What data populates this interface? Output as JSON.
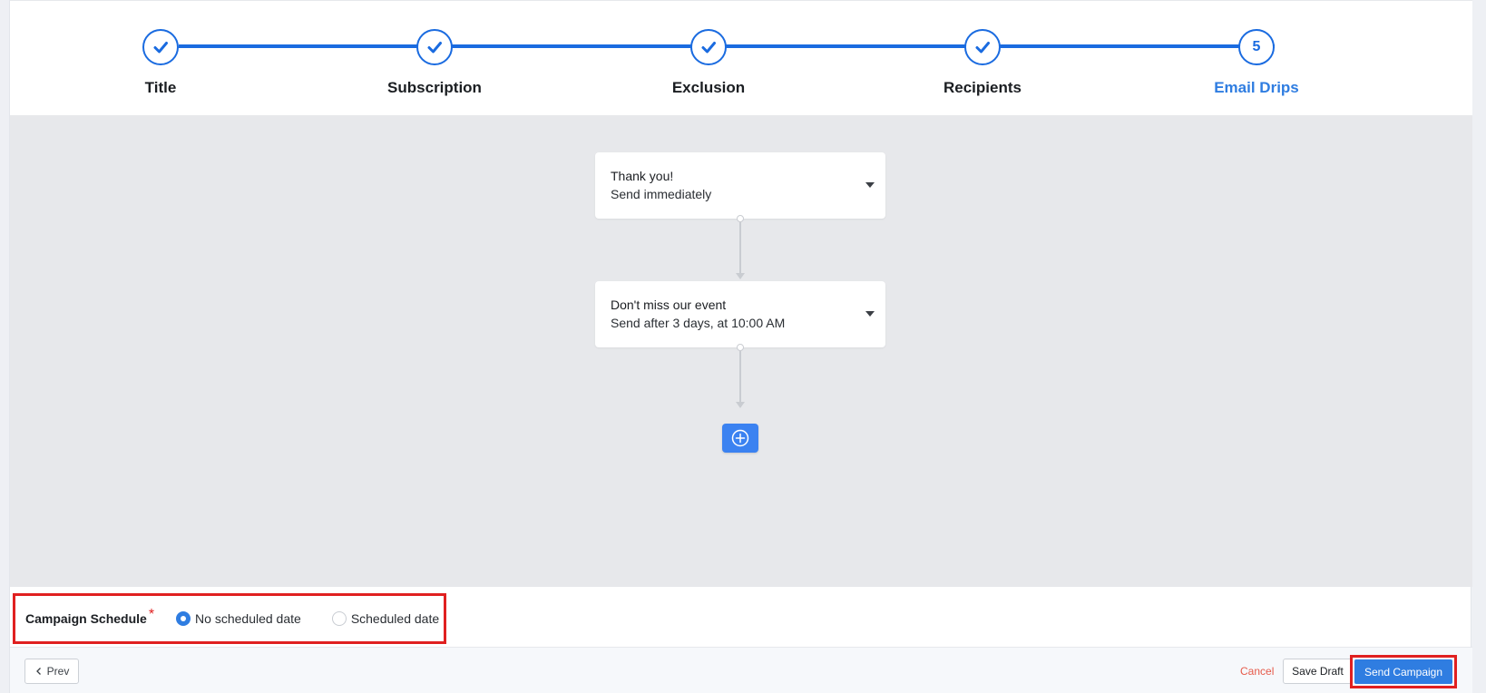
{
  "stepper": {
    "accent_color": "#1a6be0",
    "steps": [
      {
        "label": "Title",
        "state": "completed",
        "icon": "check-icon"
      },
      {
        "label": "Subscription",
        "state": "completed",
        "icon": "check-icon"
      },
      {
        "label": "Exclusion",
        "state": "completed",
        "icon": "check-icon"
      },
      {
        "label": "Recipients",
        "state": "completed",
        "icon": "check-icon"
      },
      {
        "label": "Email Drips",
        "state": "active",
        "number": "5"
      }
    ]
  },
  "drips": [
    {
      "title": "Thank you!",
      "timing": "Send immediately"
    },
    {
      "title": "Don't miss our event",
      "timing": "Send after 3 days, at 10:00 AM"
    }
  ],
  "add_button": {
    "icon": "plus-circle-icon"
  },
  "schedule": {
    "label": "Campaign Schedule",
    "required_mark": "*",
    "options": [
      {
        "label": "No scheduled date",
        "checked": true
      },
      {
        "label": "Scheduled date",
        "checked": false
      }
    ]
  },
  "footer": {
    "prev_label": "Prev",
    "cancel_label": "Cancel",
    "save_draft_label": "Save Draft",
    "send_label": "Send Campaign"
  }
}
